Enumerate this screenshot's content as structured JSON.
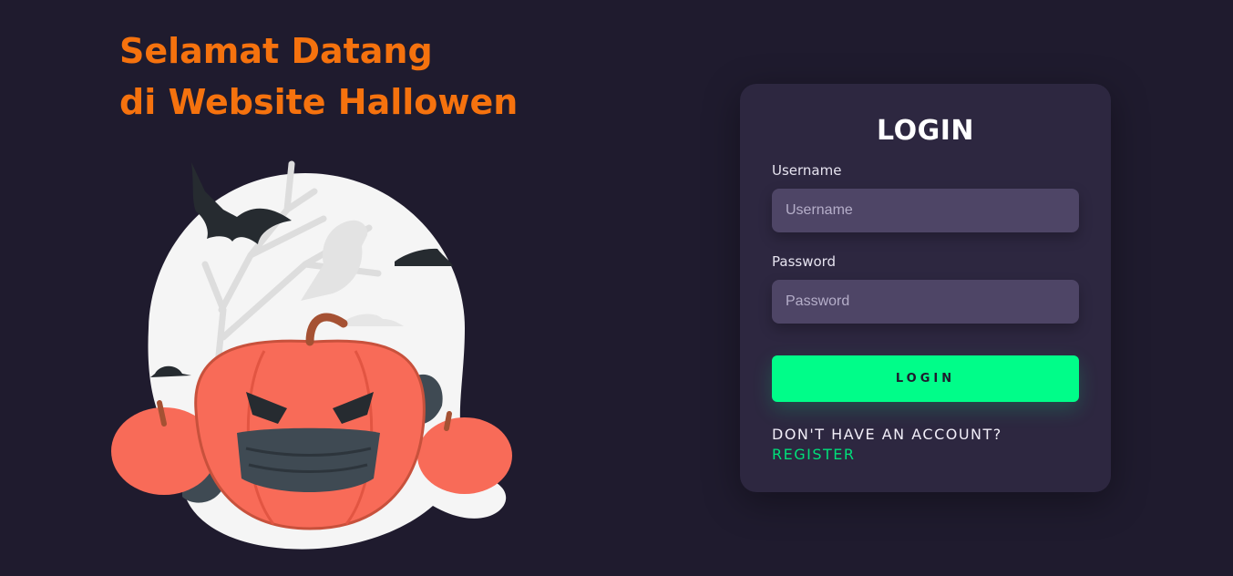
{
  "hero": {
    "line1": "Selamat Datang",
    "line2": "di Website Hallowen"
  },
  "login_card": {
    "title": "LOGIN",
    "username_label": "Username",
    "username_placeholder": "Username",
    "password_label": "Password",
    "password_placeholder": "Password",
    "submit_label": "LOGIN",
    "no_account_text": "DON'T HAVE AN ACCOUNT?",
    "register_link": "REGISTER"
  },
  "colors": {
    "background": "#1f1b2e",
    "headline": "#f5720e",
    "card": "#2d2740",
    "input": "#4e4566",
    "accent": "#00fd89"
  },
  "illustration": {
    "subject": "halloween-pumpkin-with-mask-illustration"
  }
}
